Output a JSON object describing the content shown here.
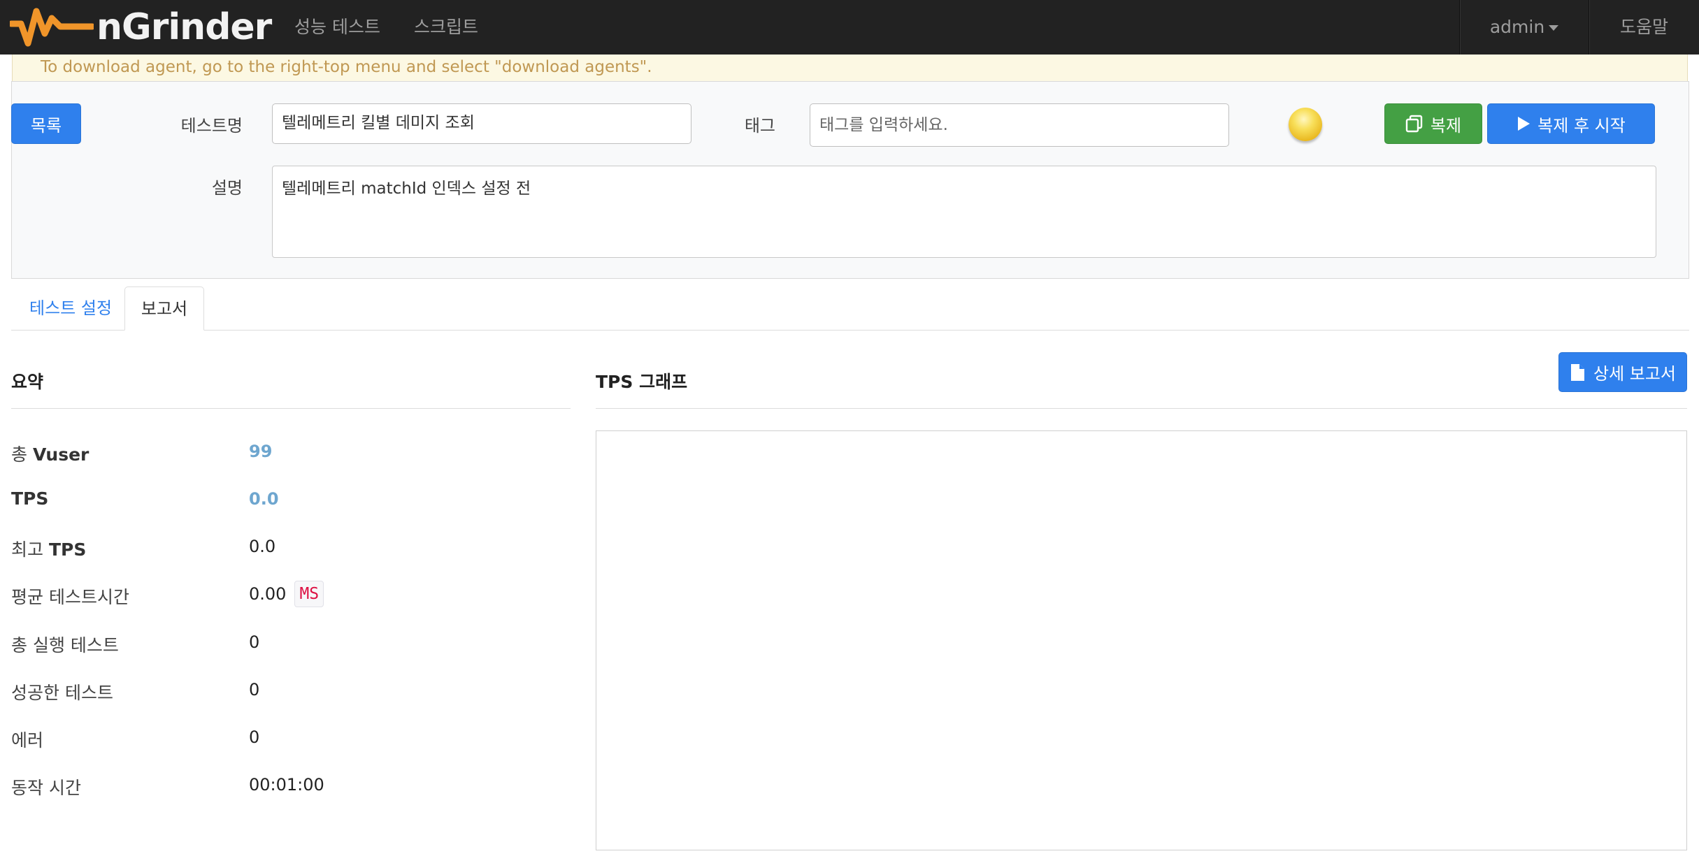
{
  "nav": {
    "brand": "nGrinder",
    "links": [
      "성능 테스트",
      "스크립트"
    ],
    "user": "admin",
    "help": "도움말"
  },
  "alert": {
    "text": "To download agent, go to the right-top menu and select \"download agents\"."
  },
  "form": {
    "list_button": "목록",
    "test_name_label": "테스트명",
    "test_name_value": "텔레메트리 킬별 데미지 조회",
    "tag_label": "태그",
    "tag_placeholder": "태그를 입력하세요.",
    "clone_button": "복제",
    "clone_start_button": "복제 후 시작",
    "desc_label": "설명",
    "desc_value": "텔레메트리 matchId 인덱스 설정 전"
  },
  "tabs": [
    {
      "label": "테스트 설정",
      "active": false
    },
    {
      "label": "보고서",
      "active": true
    }
  ],
  "summary": {
    "title": "요약",
    "rows": [
      {
        "label_pre": "총 ",
        "label_bold": "Vuser",
        "value": "99",
        "highlight": true
      },
      {
        "label_pre": "",
        "label_bold": "TPS",
        "value": "0.0",
        "highlight": true
      },
      {
        "label_pre": "최고 ",
        "label_bold": "TPS",
        "value": "0.0",
        "highlight": false
      },
      {
        "label_pre": "평균 테스트시간",
        "label_bold": "",
        "value": "0.00",
        "highlight": false,
        "unit": "MS"
      },
      {
        "label_pre": "총 실행 테스트",
        "label_bold": "",
        "value": "0",
        "highlight": false
      },
      {
        "label_pre": "성공한 테스트",
        "label_bold": "",
        "value": "0",
        "highlight": false
      },
      {
        "label_pre": "에러",
        "label_bold": "",
        "value": "0",
        "highlight": false
      },
      {
        "label_pre": "동작 시간",
        "label_bold": "",
        "value": "00:01:00",
        "highlight": false
      }
    ]
  },
  "graph": {
    "title": "TPS 그래프",
    "detail_report_button": "상세 보고서"
  },
  "colors": {
    "navbar": "#222222",
    "primary": "#2f80ed",
    "success": "#44a044",
    "alert_bg": "#fcf8e3",
    "alert_text": "#c09853",
    "highlight_value": "#6ea6cf",
    "logo_orange": "#f0952a"
  }
}
